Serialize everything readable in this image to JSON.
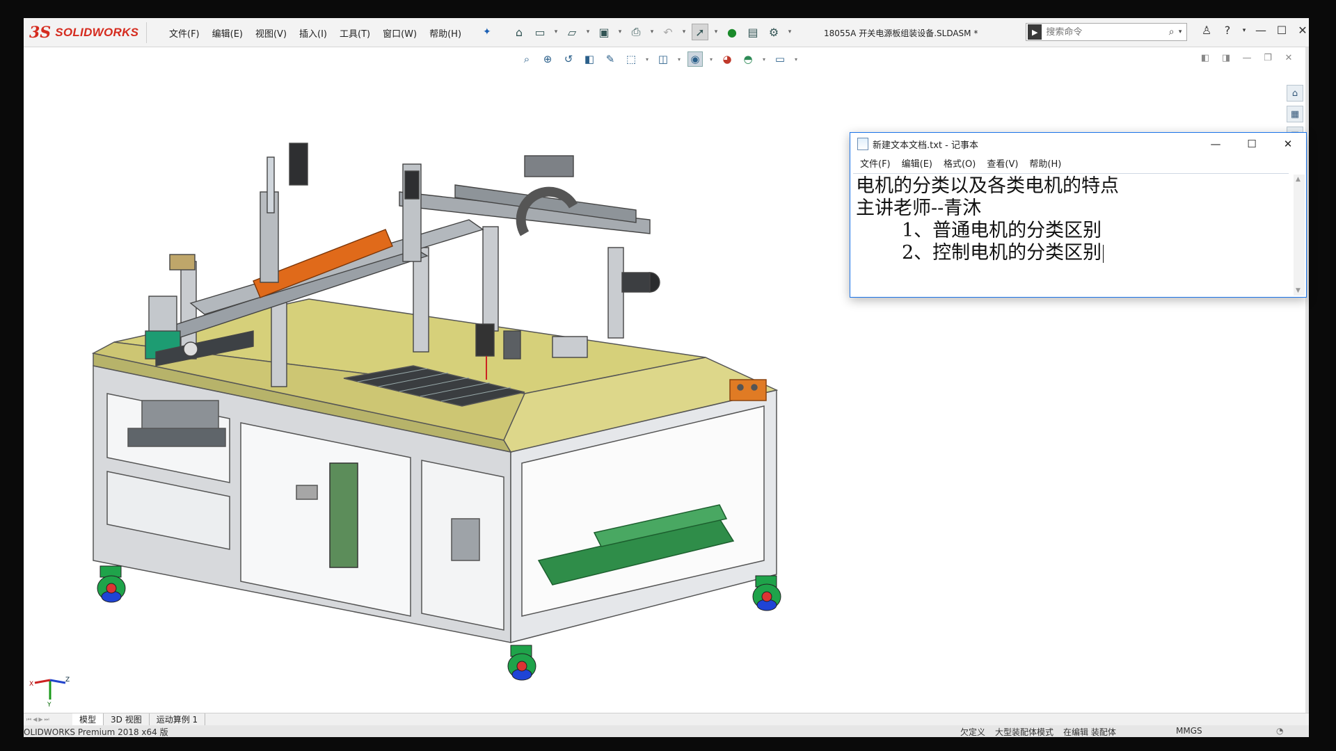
{
  "app": {
    "logo_ds": "3S",
    "logo_text": "SOLIDWORKS",
    "document_title": "18055A 开关电源板组装设备.SLDASM *"
  },
  "menu": {
    "items": [
      {
        "label": "文件(F)"
      },
      {
        "label": "编辑(E)"
      },
      {
        "label": "视图(V)"
      },
      {
        "label": "插入(I)"
      },
      {
        "label": "工具(T)"
      },
      {
        "label": "窗口(W)"
      },
      {
        "label": "帮助(H)"
      }
    ]
  },
  "search": {
    "placeholder": "搜索命令"
  },
  "tabs": [
    {
      "label": "模型",
      "active": true
    },
    {
      "label": "3D 视图",
      "active": false
    },
    {
      "label": "运动算例 1",
      "active": false
    }
  ],
  "status": {
    "left": "OLIDWORKS Premium 2018 x64 版",
    "right": [
      "欠定义",
      "大型装配体模式",
      "在编辑 装配体"
    ],
    "units": "MMGS"
  },
  "notepad": {
    "title": "新建文本文档.txt - 记事本",
    "menu": [
      "文件(F)",
      "编辑(E)",
      "格式(O)",
      "查看(V)",
      "帮助(H)"
    ],
    "lines": [
      "电机的分类以及各类电机的特点",
      "主讲老师--青沐",
      "1、普通电机的分类区别",
      "2、控制电机的分类区别"
    ]
  },
  "triad": {
    "x": "X",
    "y": "Y",
    "z": "Z"
  },
  "colors": {
    "brand": "#d52b1e",
    "table_top": "#d6d07a",
    "motor_orange": "#e06a1a",
    "caster_green": "#1fa34a",
    "caster_blue": "#1f44d6",
    "notepad_border": "#1a73e8"
  },
  "icons": {
    "toolbar": [
      "home-icon",
      "new-document-icon",
      "open-folder-icon",
      "save-icon",
      "print-icon",
      "undo-icon",
      "select-arrow-icon",
      "traffic-light-icon",
      "file-properties-icon",
      "options-gear-icon"
    ],
    "view": [
      "zoom-to-fit-icon",
      "zoom-area-icon",
      "previous-view-icon",
      "section-view-icon",
      "dynamic-annotation-icon",
      "view-orientation-icon",
      "display-style-icon",
      "hide-show-icon",
      "edit-appearance-icon",
      "apply-scene-icon",
      "view-settings-icon"
    ]
  }
}
